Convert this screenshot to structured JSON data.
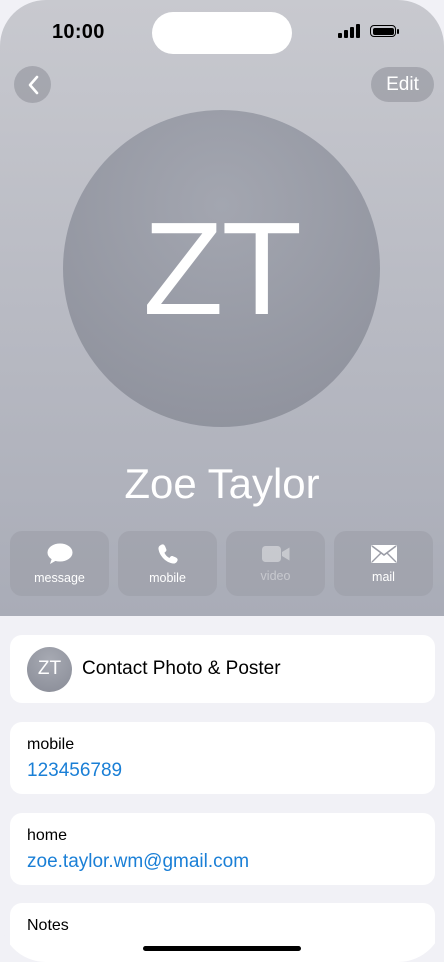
{
  "status_bar": {
    "time": "10:00"
  },
  "nav": {
    "edit_label": "Edit"
  },
  "contact": {
    "initials": "ZT",
    "name": "Zoe Taylor"
  },
  "actions": [
    {
      "label": "message",
      "icon": "message-icon",
      "enabled": true
    },
    {
      "label": "mobile",
      "icon": "phone-icon",
      "enabled": true
    },
    {
      "label": "video",
      "icon": "video-icon",
      "enabled": false
    },
    {
      "label": "mail",
      "icon": "mail-icon",
      "enabled": true
    }
  ],
  "photo_poster": {
    "initials": "ZT",
    "label": "Contact Photo & Poster"
  },
  "fields": {
    "mobile": {
      "label": "mobile",
      "value": "123456789"
    },
    "home": {
      "label": "home",
      "value": "zoe.taylor.wm@gmail.com"
    },
    "notes": {
      "label": "Notes"
    }
  },
  "colors": {
    "link": "#1a7fd6",
    "header_top": "#c8c9cf",
    "header_bottom": "#a9acb7"
  }
}
